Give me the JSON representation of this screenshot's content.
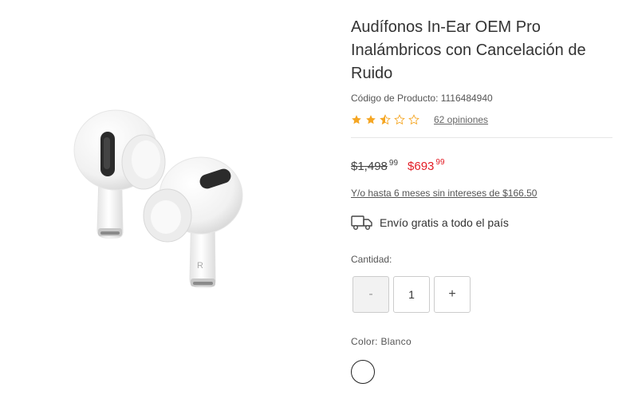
{
  "product": {
    "image_alt": "airpods-image",
    "title": "Audífonos In-Ear OEM Pro Inalámbricos con Cancelación de Ruido",
    "code_label": "Código de Producto: 1116484940",
    "rating": 2.5,
    "rating_max": 5,
    "reviews": "62 opiniones"
  },
  "pricing": {
    "old_price": "$1,498",
    "old_cents": "99",
    "new_price": "$693",
    "new_cents": "99",
    "installments": "Y/o hasta 6 meses sin intereses de $166.50",
    "sale_color": "#e31c25",
    "star_color": "#f5a623"
  },
  "shipping": {
    "icon": "truck-icon",
    "text": "Envío gratis a todo el país"
  },
  "quantity": {
    "label": "Cantidad:",
    "minus": "-",
    "value": "1",
    "plus": "+"
  },
  "color": {
    "label": "Color: Blanco",
    "selected": "Blanco",
    "swatch": "#ffffff"
  },
  "earbud_mark": "R"
}
